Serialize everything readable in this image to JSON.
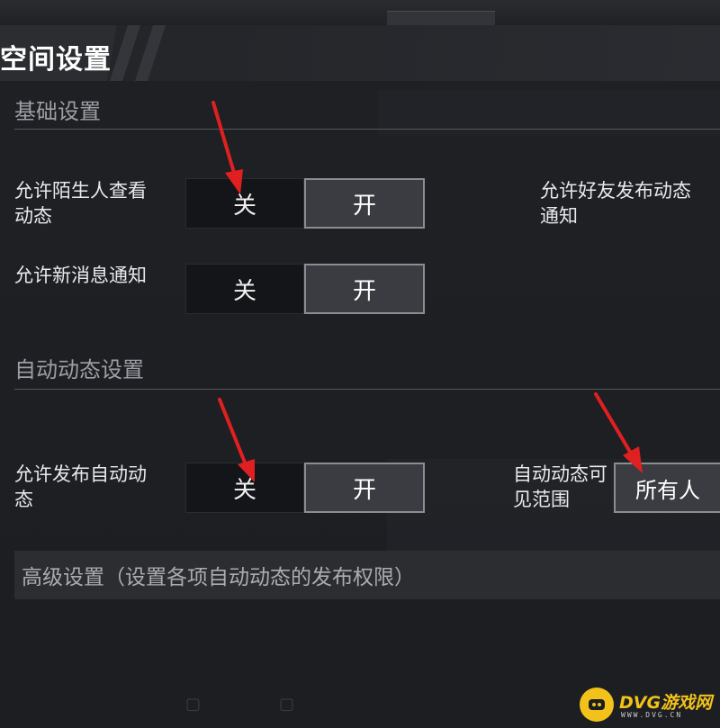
{
  "header": {
    "title": "空间设置"
  },
  "basic": {
    "title": "基础设置",
    "stranger_view": {
      "label": "允许陌生人查看动态",
      "off": "关",
      "on": "开"
    },
    "friend_notify": {
      "label": "允许好友发布动态通知"
    },
    "new_message": {
      "label": "允许新消息通知",
      "off": "关",
      "on": "开"
    }
  },
  "auto": {
    "title": "自动动态设置",
    "publish": {
      "label": "允许发布自动动态",
      "off": "关",
      "on": "开"
    },
    "visibility": {
      "label": "自动动态可见范围",
      "value": "所有人"
    }
  },
  "advanced": {
    "label": "高级设置（设置各项自动动态的发布权限）"
  },
  "watermark": {
    "brand": "DVG游戏网",
    "url": "WWW.DVG.CN"
  },
  "colors": {
    "arrow": "#e02020",
    "accent": "#f2c21b",
    "background": "#1b1d21"
  },
  "icons": [
    "arrow-icon",
    "watermark-logo-icon"
  ]
}
